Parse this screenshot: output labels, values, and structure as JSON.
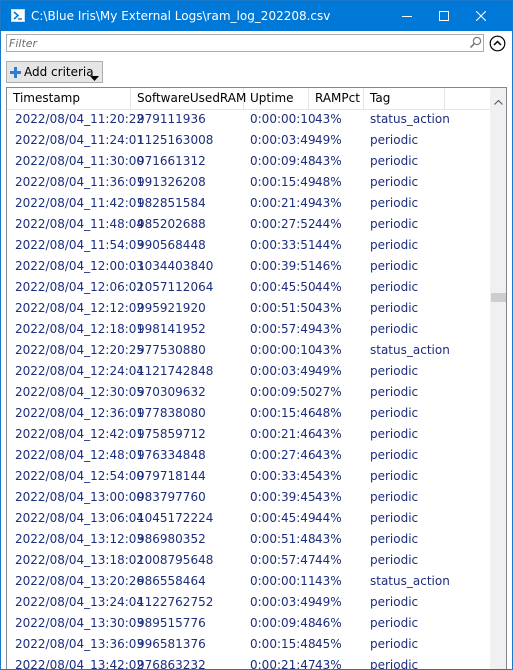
{
  "window": {
    "title": "C:\\Blue Iris\\My External Logs\\ram_log_202208.csv"
  },
  "filter": {
    "placeholder": "Filter",
    "value": ""
  },
  "toolbar": {
    "add_criteria_label": "Add criteria"
  },
  "grid": {
    "columns": [
      "Timestamp",
      "SoftwareUsedRAM",
      "Uptime",
      "RAMPct",
      "Tag"
    ],
    "rows": [
      [
        "2022/08/04_11:20:22",
        "979111936",
        "0:00:00:10",
        "43%",
        "status_action"
      ],
      [
        "2022/08/04_11:24:01",
        "1125163008",
        "0:00:03:49",
        "49%",
        "periodic"
      ],
      [
        "2022/08/04_11:30:00",
        "971661312",
        "0:00:09:48",
        "43%",
        "periodic"
      ],
      [
        "2022/08/04_11:36:01",
        "991326208",
        "0:00:15:49",
        "48%",
        "periodic"
      ],
      [
        "2022/08/04_11:42:01",
        "982851584",
        "0:00:21:49",
        "43%",
        "periodic"
      ],
      [
        "2022/08/04_11:48:04",
        "985202688",
        "0:00:27:52",
        "44%",
        "periodic"
      ],
      [
        "2022/08/04_11:54:03",
        "990568448",
        "0:00:33:51",
        "44%",
        "periodic"
      ],
      [
        "2022/08/04_12:00:03",
        "1034403840",
        "0:00:39:51",
        "46%",
        "periodic"
      ],
      [
        "2022/08/04_12:06:02",
        "1057112064",
        "0:00:45:50",
        "44%",
        "periodic"
      ],
      [
        "2022/08/04_12:12:02",
        "995921920",
        "0:00:51:50",
        "43%",
        "periodic"
      ],
      [
        "2022/08/04_12:18:01",
        "998141952",
        "0:00:57:49",
        "43%",
        "periodic"
      ],
      [
        "2022/08/04_12:20:25",
        "977530880",
        "0:00:00:10",
        "43%",
        "status_action"
      ],
      [
        "2022/08/04_12:24:04",
        "1121742848",
        "0:00:03:49",
        "49%",
        "periodic"
      ],
      [
        "2022/08/04_12:30:05",
        "970309632",
        "0:00:09:50",
        "27%",
        "periodic"
      ],
      [
        "2022/08/04_12:36:01",
        "977838080",
        "0:00:15:46",
        "48%",
        "periodic"
      ],
      [
        "2022/08/04_12:42:01",
        "975859712",
        "0:00:21:46",
        "43%",
        "periodic"
      ],
      [
        "2022/08/04_12:48:01",
        "976334848",
        "0:00:27:46",
        "43%",
        "periodic"
      ],
      [
        "2022/08/04_12:54:00",
        "979718144",
        "0:00:33:45",
        "43%",
        "periodic"
      ],
      [
        "2022/08/04_13:00:00",
        "983797760",
        "0:00:39:45",
        "43%",
        "periodic"
      ],
      [
        "2022/08/04_13:06:04",
        "1045172224",
        "0:00:45:49",
        "44%",
        "periodic"
      ],
      [
        "2022/08/04_13:12:03",
        "986980352",
        "0:00:51:48",
        "43%",
        "periodic"
      ],
      [
        "2022/08/04_13:18:02",
        "1008795648",
        "0:00:57:47",
        "44%",
        "periodic"
      ],
      [
        "2022/08/04_13:20:26",
        "986558464",
        "0:00:00:11",
        "43%",
        "status_action"
      ],
      [
        "2022/08/04_13:24:04",
        "1122762752",
        "0:00:03:49",
        "49%",
        "periodic"
      ],
      [
        "2022/08/04_13:30:03",
        "989515776",
        "0:00:09:48",
        "46%",
        "periodic"
      ],
      [
        "2022/08/04_13:36:03",
        "996581376",
        "0:00:15:48",
        "45%",
        "periodic"
      ],
      [
        "2022/08/04_13:42:02",
        "976863232",
        "0:00:21:47",
        "43%",
        "periodic"
      ]
    ]
  },
  "icons": {
    "app": "powershell-icon",
    "minimize": "minimize-icon",
    "maximize": "maximize-icon",
    "close": "close-icon",
    "search": "search-icon",
    "collapse": "chevron-up-circle-icon",
    "add": "plus-icon",
    "dropdown": "caret-down-icon",
    "scroll_up": "scroll-up-arrow-icon"
  },
  "colors": {
    "titlebar": "#0078d7",
    "cell_text": "#1c2d7d",
    "add_icon": "#2e7dd2"
  },
  "scroll": {
    "position_fraction": 0.34
  }
}
